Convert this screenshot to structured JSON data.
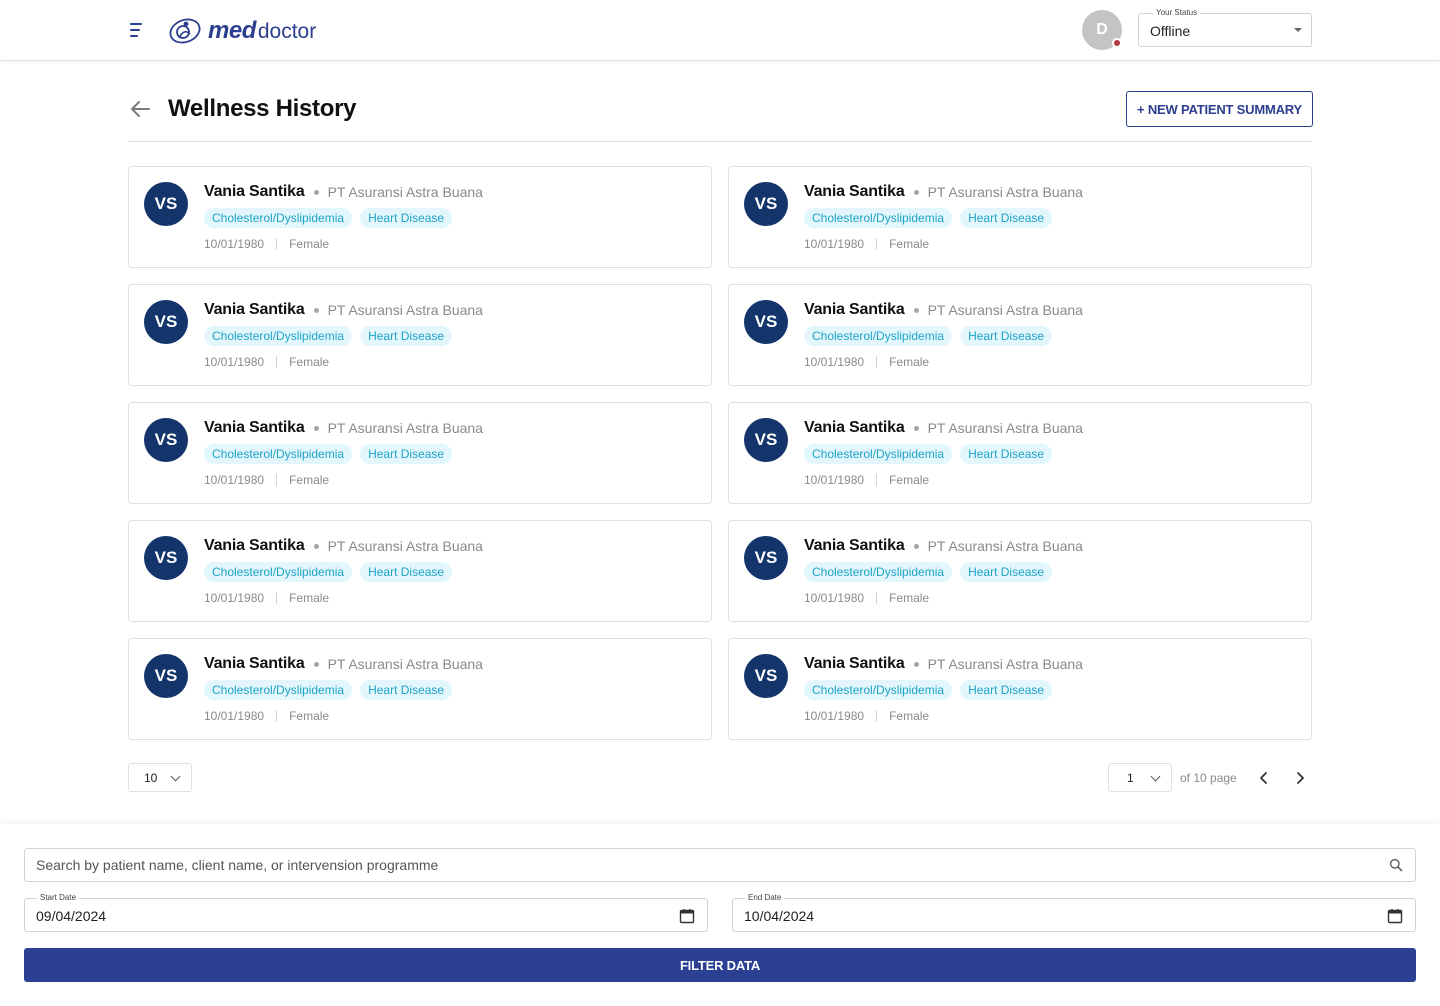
{
  "header": {
    "logo_med": "med",
    "logo_doctor": "doctor",
    "avatar_initial": "D",
    "status_label": "Your Status",
    "status_value": "Offline",
    "status_dot_color": "#b5343d"
  },
  "page": {
    "title": "Wellness History",
    "new_summary_label": "+ NEW PATIENT SUMMARY"
  },
  "patients": [
    {
      "initials": "VS",
      "name": "Vania Santika",
      "company": "PT Asuransi Astra Buana",
      "tags": [
        "Cholesterol/Dyslipidemia",
        "Heart Disease"
      ],
      "dob": "10/01/1980",
      "gender": "Female"
    },
    {
      "initials": "VS",
      "name": "Vania Santika",
      "company": "PT Asuransi Astra Buana",
      "tags": [
        "Cholesterol/Dyslipidemia",
        "Heart Disease"
      ],
      "dob": "10/01/1980",
      "gender": "Female"
    },
    {
      "initials": "VS",
      "name": "Vania Santika",
      "company": "PT Asuransi Astra Buana",
      "tags": [
        "Cholesterol/Dyslipidemia",
        "Heart Disease"
      ],
      "dob": "10/01/1980",
      "gender": "Female"
    },
    {
      "initials": "VS",
      "name": "Vania Santika",
      "company": "PT Asuransi Astra Buana",
      "tags": [
        "Cholesterol/Dyslipidemia",
        "Heart Disease"
      ],
      "dob": "10/01/1980",
      "gender": "Female"
    },
    {
      "initials": "VS",
      "name": "Vania Santika",
      "company": "PT Asuransi Astra Buana",
      "tags": [
        "Cholesterol/Dyslipidemia",
        "Heart Disease"
      ],
      "dob": "10/01/1980",
      "gender": "Female"
    },
    {
      "initials": "VS",
      "name": "Vania Santika",
      "company": "PT Asuransi Astra Buana",
      "tags": [
        "Cholesterol/Dyslipidemia",
        "Heart Disease"
      ],
      "dob": "10/01/1980",
      "gender": "Female"
    },
    {
      "initials": "VS",
      "name": "Vania Santika",
      "company": "PT Asuransi Astra Buana",
      "tags": [
        "Cholesterol/Dyslipidemia",
        "Heart Disease"
      ],
      "dob": "10/01/1980",
      "gender": "Female"
    },
    {
      "initials": "VS",
      "name": "Vania Santika",
      "company": "PT Asuransi Astra Buana",
      "tags": [
        "Cholesterol/Dyslipidemia",
        "Heart Disease"
      ],
      "dob": "10/01/1980",
      "gender": "Female"
    },
    {
      "initials": "VS",
      "name": "Vania Santika",
      "company": "PT Asuransi Astra Buana",
      "tags": [
        "Cholesterol/Dyslipidemia",
        "Heart Disease"
      ],
      "dob": "10/01/1980",
      "gender": "Female"
    },
    {
      "initials": "VS",
      "name": "Vania Santika",
      "company": "PT Asuransi Astra Buana",
      "tags": [
        "Cholesterol/Dyslipidemia",
        "Heart Disease"
      ],
      "dob": "10/01/1980",
      "gender": "Female"
    }
  ],
  "pagination": {
    "per_page": "10",
    "current_page": "1",
    "of_pages": "of 10 page"
  },
  "filters": {
    "search_placeholder": "Search by patient name, client name, or intervension programme",
    "start_date_label": "Start Date",
    "start_date_value": "09/04/2024",
    "end_date_label": "End Date",
    "end_date_value": "10/04/2024",
    "filter_button_label": "FILTER DATA"
  },
  "colors": {
    "brand": "#2c3e8f",
    "avatar_navy": "#13356b",
    "tag_bg": "#e2f6fb",
    "tag_text": "#1ea4c9",
    "filter_button": "#2b3f93"
  }
}
